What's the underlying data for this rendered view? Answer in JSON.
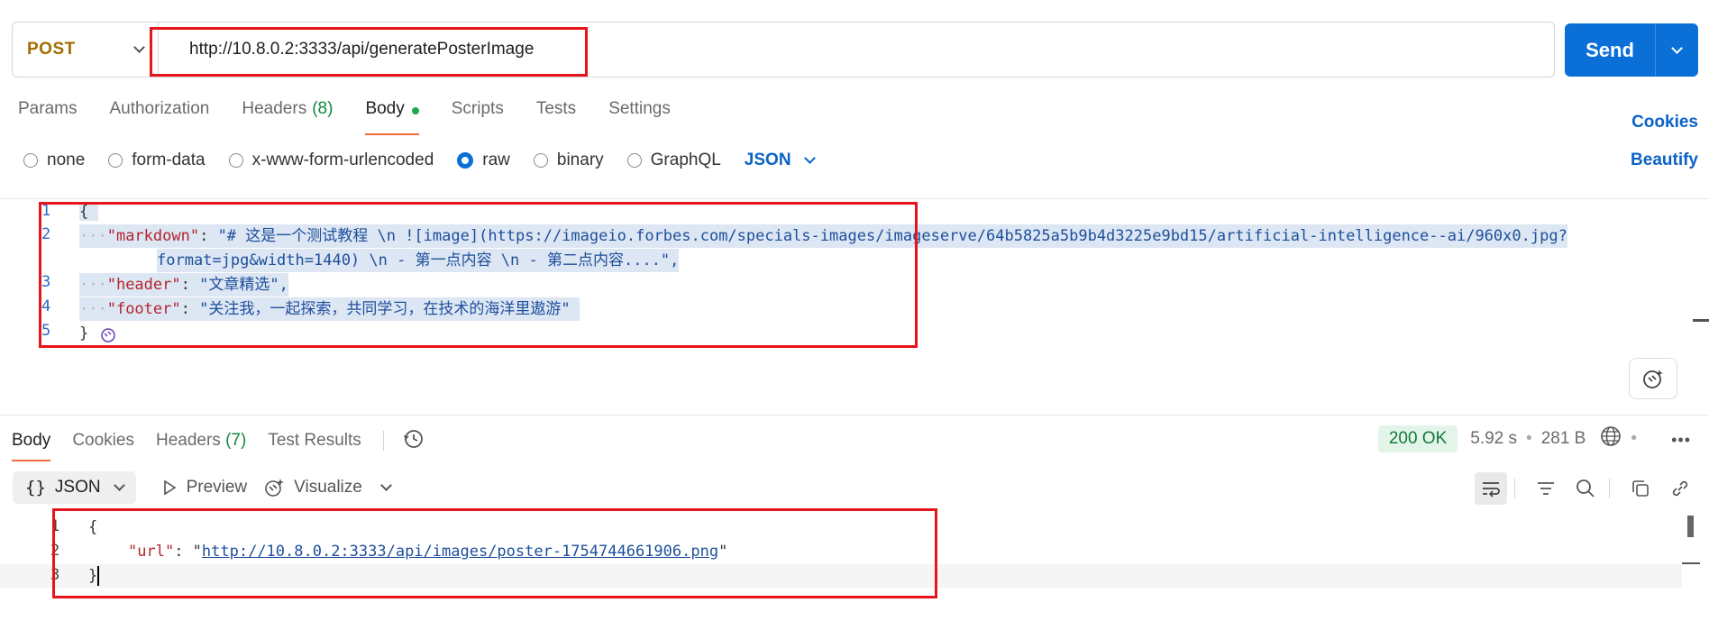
{
  "request": {
    "method": "POST",
    "url": "http://10.8.0.2:3333/api/generatePosterImage",
    "send_label": "Send"
  },
  "request_tabs": [
    {
      "label": "Params"
    },
    {
      "label": "Authorization"
    },
    {
      "label": "Headers",
      "count": "(8)"
    },
    {
      "label": "Body",
      "active": true
    },
    {
      "label": "Scripts"
    },
    {
      "label": "Tests"
    },
    {
      "label": "Settings"
    }
  ],
  "cookies_label": "Cookies",
  "beautify_label": "Beautify",
  "body_types": [
    "none",
    "form-data",
    "x-www-form-urlencoded",
    "raw",
    "binary",
    "GraphQL"
  ],
  "body_type_selected": "raw",
  "body_format": "JSON",
  "request_body": {
    "line_numbers": [
      "1",
      "2",
      "3",
      "4",
      "5"
    ],
    "open": "{",
    "close": "}",
    "markdown_key": "\"markdown\"",
    "markdown_value_1": "\"# 这是一个测试教程 \\n ![image](https://imageio.forbes.com/specials-images/imageserve/64b5825a5b9b4d3225e9bd15/artificial-intelligence--ai/960x0.jpg?",
    "markdown_value_2": "format=jpg&width=1440) \\n - 第一点内容 \\n - 第二点内容....\",",
    "header_key": "\"header\"",
    "header_value": "\"文章精选\",",
    "footer_key": "\"footer\"",
    "footer_value": "\"关注我，一起探索，共同学习，在技术的海洋里遨游\""
  },
  "response_tabs": [
    {
      "label": "Body",
      "active": true
    },
    {
      "label": "Cookies"
    },
    {
      "label": "Headers",
      "count": "(7)"
    },
    {
      "label": "Test Results"
    }
  ],
  "response_status": {
    "code": "200 OK",
    "time": "5.92 s",
    "size": "281 B"
  },
  "response_toolbar": {
    "format_label": "JSON",
    "preview_label": "Preview",
    "visualize_label": "Visualize"
  },
  "response_body": {
    "line_numbers": [
      "1",
      "2",
      "3"
    ],
    "open": "{",
    "close": "}",
    "url_key": "\"url\"",
    "url_value": "http://10.8.0.2:3333/api/images/poster-1754744661906.png"
  },
  "colors": {
    "accent": "#0b6fd8",
    "method": "#a46b00",
    "highlight_box": "#e8141c",
    "tab_underline": "#f26b3a",
    "status_ok": "#107a38"
  }
}
